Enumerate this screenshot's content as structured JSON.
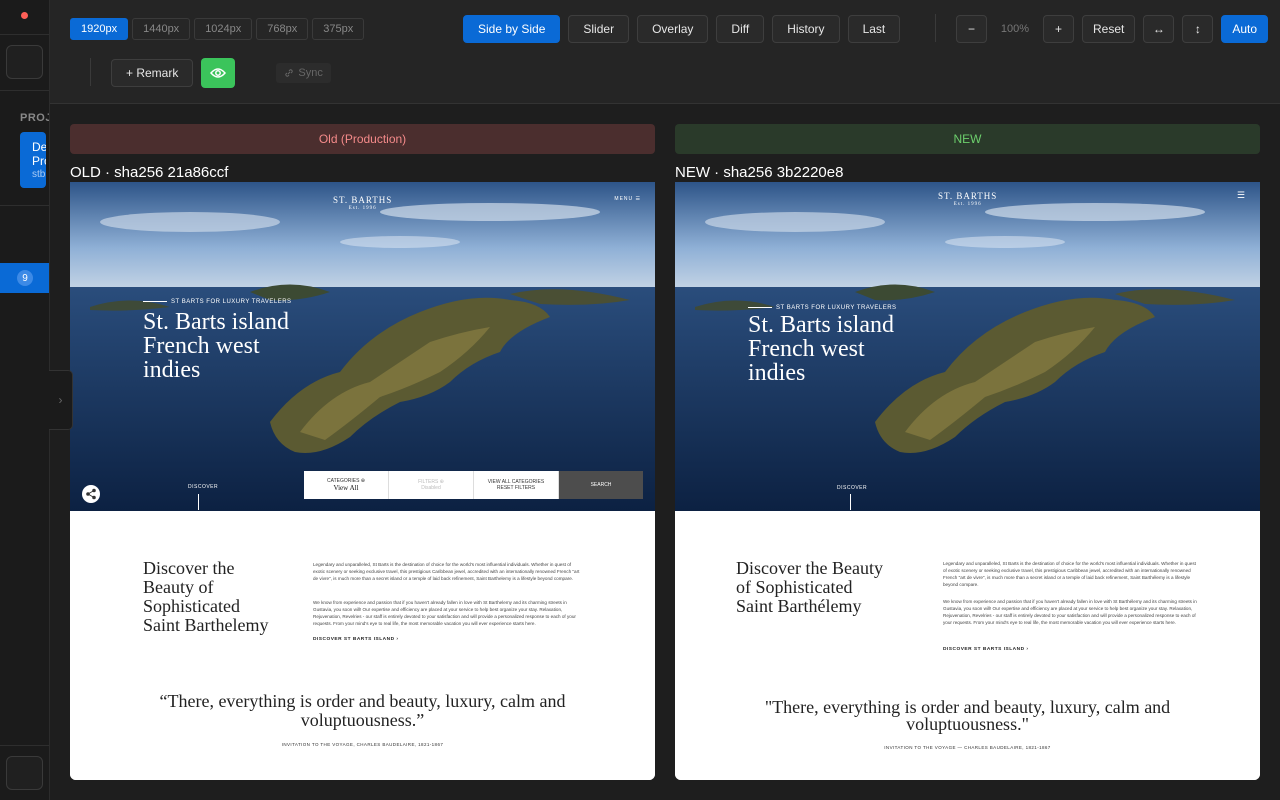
{
  "sidebar": {
    "project_label": "PROJ",
    "card_title_1": "De",
    "card_title_2": "Pro",
    "card_sub": "stb",
    "badge": "9",
    "top_icon": "",
    "bottom_icon": "",
    "handle_icon": "›"
  },
  "toolbar": {
    "viewports": [
      "1920px",
      "1440px",
      "1024px",
      "768px",
      "375px"
    ],
    "modes": [
      "Side by Side",
      "Slider",
      "Overlay",
      "Diff",
      "History",
      "Last"
    ],
    "zoom_out": "−",
    "zoom_value": "100%",
    "zoom_in": "+",
    "reset": "Reset",
    "fit_width": "↔",
    "fit_height": "↕",
    "auto": "Auto",
    "remark": "+ Remark",
    "sync": "Sync"
  },
  "old_panel": {
    "header": "Old (Production)",
    "title": "OLD · sha256 21a86ccf"
  },
  "new_panel": {
    "header": "NEW",
    "title": "NEW · sha256 3b2220e8"
  },
  "site_old": {
    "logo": "ST. BARTHS",
    "logo_sub": "Est. 1996",
    "menu": "MENU ☰",
    "eyebrow": "ST BARTS FOR LUXURY TRAVELERS",
    "title_1": "St. Barts island",
    "title_2": "French west",
    "title_3": "indies",
    "discover": "DISCOVER",
    "search": {
      "cell1_label": "CATEGORIES ⊕",
      "cell1_value": "View All",
      "cell2_label": "FILTERS ⊕",
      "cell2_value": "Disabled",
      "cell3_label": "VIEW ALL CATEGORIES",
      "cell3_value": "RESET FILTERS",
      "button": "SEARCH"
    },
    "heading_1": "Discover the",
    "heading_2": "Beauty of",
    "heading_3": "Sophisticated",
    "heading_4": "Saint Barthelemy",
    "para_1": "Legendary and unparalleled, St Barts is the destination of choice for the world's most influential individuals. Whether in quest of exotic scenery or seeking exclusive travel, this prestigious Caribbean jewel, accredited with an internationally renowned French \"art de vivre\", is much more than a secret island or a temple of laid back refinement, Saint Barthelemy is a lifestyle beyond compare.",
    "para_2": "We know from experience and passion that if you haven't already fallen in love with St Barthelemy and its charming streets in Gustavia, you soon will! Our expertise and efficiency are placed at your service to help best organize your stay. Relaxation, Rejuvenation, Revelries - our staff is entirely devoted to your satisfaction and will provide a personalized response to each of your requests. From your mind's eye to real life, the most memorable vacation you will ever experience starts here.",
    "link": "DISCOVER ST BARTS ISLAND ›",
    "quote_1": "“There, everything is order and beauty, luxury, calm and",
    "quote_2": "voluptuousness.”",
    "cite": "INVITATION TO THE VOYAGE, CHARLES BAUDELAIRE, 1821-1867"
  },
  "site_new": {
    "logo": "ST. BARTHS",
    "logo_sub": "Est. 1996",
    "menu": "☰",
    "eyebrow": "ST BARTS FOR LUXURY TRAVELERS",
    "title_1": "St. Barts island",
    "title_2": "French west",
    "title_3": "indies",
    "discover": "DISCOVER",
    "heading_1": "Discover the Beauty",
    "heading_2": "of Sophisticated",
    "heading_3": "Saint Barthélemy",
    "para_1": "Legendary and unparalleled, St Barts is the destination of choice for the world's most influential individuals. Whether in quest of exotic scenery or seeking exclusive travel, this prestigious Caribbean jewel, accredited with an internationally renowned French \"art de vivre\", is much more than a secret island or a temple of laid back refinement, Saint Barthélemy is a lifestyle beyond compare.",
    "para_2": "We know from experience and passion that if you haven't already fallen in love with St Barthélemy and its charming streets in Gustavia, you soon will! Our expertise and efficiency are placed at your service to help best organize your stay. Relaxation, Rejuvenation, Revelries - our staff is entirely devoted to your satisfaction and will provide a personalized response to each of your requests. From your mind's eye to real life, the most memorable vacation you will ever experience starts here.",
    "link": "DISCOVER ST BARTS ISLAND ›",
    "quote_1": "\"There, everything is order and beauty, luxury, calm and",
    "quote_2": "voluptuousness.\"",
    "cite": "INVITATION TO THE VOYAGE — CHARLES BAUDELAIRE, 1821-1867"
  }
}
